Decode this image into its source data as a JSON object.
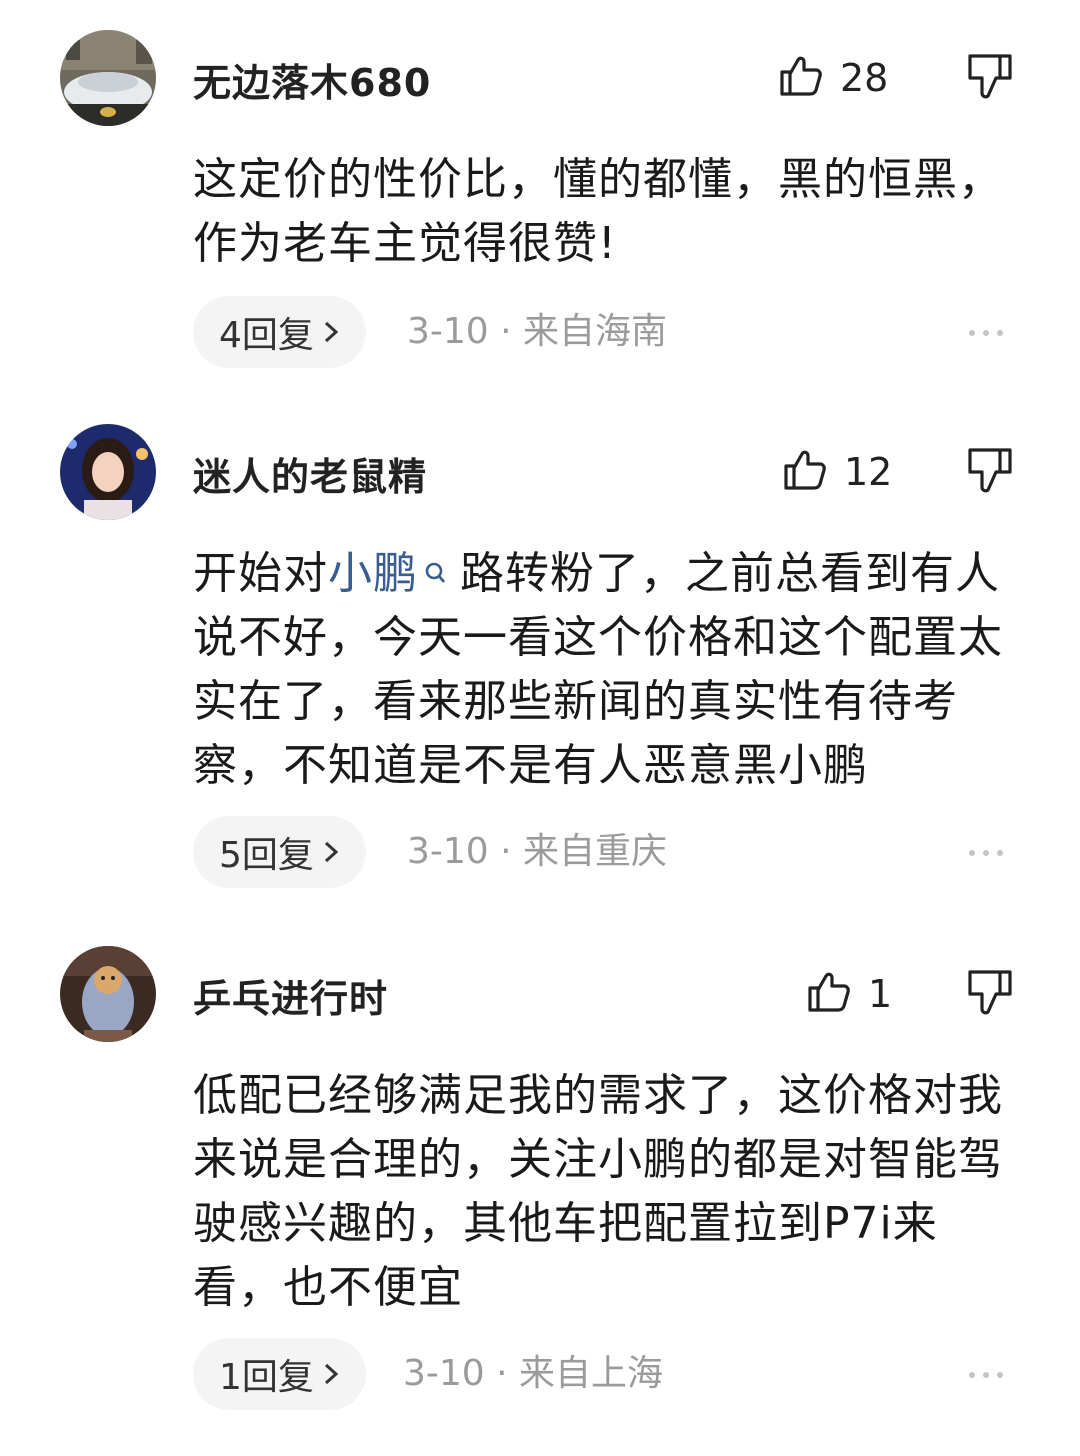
{
  "comments": [
    {
      "username": "无边落木680",
      "likes": "28",
      "text": "这定价的性价比，懂的都懂，黑的恒黑，作为老车主觉得很赞!",
      "replies": "4回复",
      "date": "3-10",
      "location": "来自海南",
      "avatar_icon": "car-photo"
    },
    {
      "username": "迷人的老鼠精",
      "likes": "12",
      "text_before": "开始对",
      "link_word": "小鹏",
      "text_after": "路转粉了，之前总看到有人说不好，今天一看这个价格和这个配置太实在了，看来那些新闻的真实性有待考察，不知道是不是有人恶意黑小鹏",
      "replies": "5回复",
      "date": "3-10",
      "location": "来自重庆",
      "avatar_icon": "person-photo"
    },
    {
      "username": "乒乓进行时",
      "likes": "1",
      "text": "低配已经够满足我的需求了，这价格对我来说是合理的，关注小鹏的都是对智能驾驶感兴趣的，其他车把配置拉到P7i来看，也不便宜",
      "replies": "1回复",
      "date": "3-10",
      "location": "来自上海",
      "avatar_icon": "dog-photo"
    }
  ],
  "separator": " · ",
  "colors": {
    "link": "#3a5d8f",
    "meta": "#9b9b9b",
    "pill_bg": "#f4f4f4"
  }
}
